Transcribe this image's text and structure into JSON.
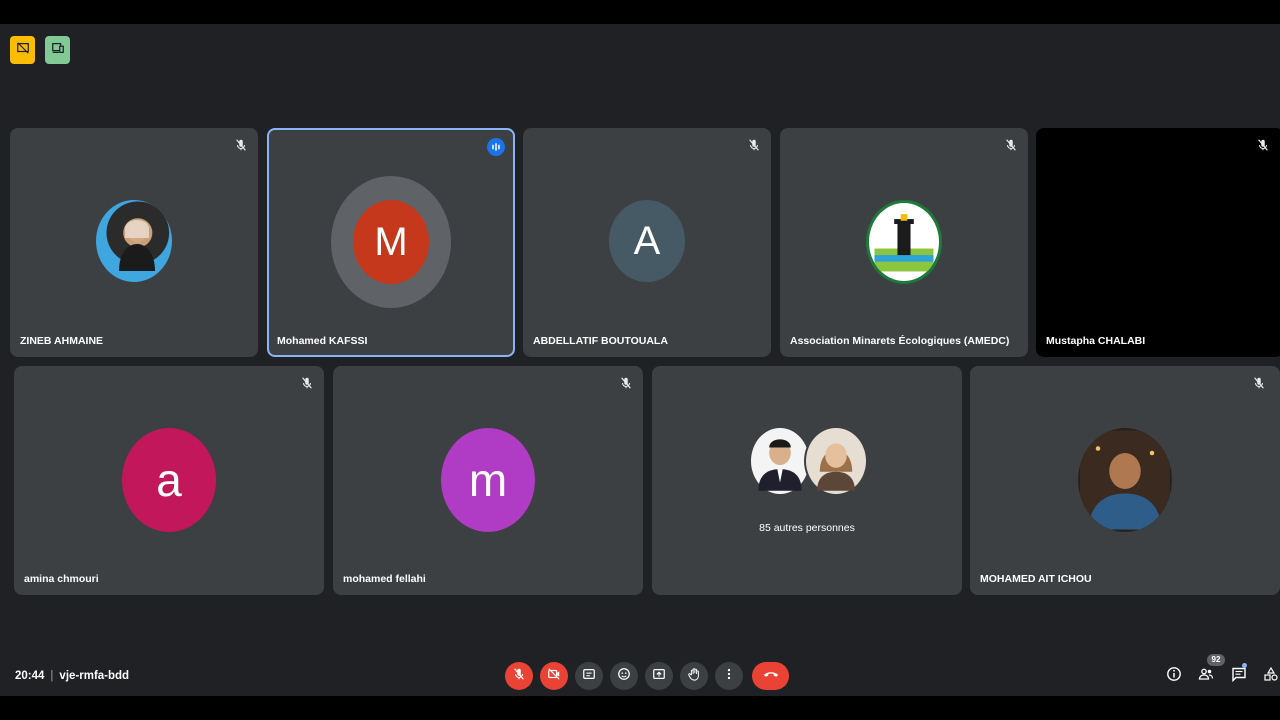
{
  "top_badges": [
    {
      "icon": "presentation-off-icon",
      "color": "#fbbc04"
    },
    {
      "icon": "devices-icon",
      "color": "#81c995"
    }
  ],
  "participants": [
    {
      "name": "ZINEB AHMAINE",
      "avatar_type": "photo",
      "icon": "mic-off-icon"
    },
    {
      "name": "Mohamed KAFSSI",
      "avatar_type": "letter",
      "letter": "M",
      "color": "#c5381b",
      "speaking": true,
      "icon": "speaking-icon"
    },
    {
      "name": "ABDELLATIF BOUTOUALA",
      "avatar_type": "letter",
      "letter": "A",
      "color": "#455a64",
      "icon": "mic-off-icon"
    },
    {
      "name": "Association Minarets Écologiques (AMEDC)",
      "avatar_type": "logo",
      "icon": "mic-off-icon"
    },
    {
      "name": "Mustapha CHALABI",
      "avatar_type": "video-off",
      "icon": "mic-off-icon"
    },
    {
      "name": "amina chmouri",
      "avatar_type": "letter",
      "letter": "a",
      "color": "#c2185b",
      "icon": "mic-off-icon"
    },
    {
      "name": "mohamed fellahi",
      "avatar_type": "letter",
      "letter": "m",
      "color": "#b03bc4",
      "icon": "mic-off-icon"
    },
    {
      "name": "MOHAMED AIT ICHOU",
      "avatar_type": "photo",
      "icon": "mic-off-icon"
    }
  ],
  "others_tile": {
    "label": "85 autres personnes"
  },
  "meeting": {
    "time": "20:44",
    "separator": "|",
    "code": "vje-rmfa-bdd"
  },
  "controls": [
    {
      "name": "microphone-toggle",
      "icon": "mic-off-icon",
      "state": "off"
    },
    {
      "name": "camera-toggle",
      "icon": "camera-off-icon",
      "state": "off"
    },
    {
      "name": "captions",
      "icon": "captions-icon"
    },
    {
      "name": "reactions",
      "icon": "emoji-icon"
    },
    {
      "name": "present",
      "icon": "present-icon"
    },
    {
      "name": "raise-hand",
      "icon": "hand-icon"
    },
    {
      "name": "more-options",
      "icon": "more-vert-icon"
    },
    {
      "name": "leave-call",
      "icon": "hangup-icon"
    }
  ],
  "right_panel": {
    "info_icon": "info-icon",
    "people_icon": "people-icon",
    "people_count": "92",
    "chat_icon": "chat-icon",
    "activities_icon": "activities-icon"
  },
  "colors": {
    "background": "#202124",
    "tile": "#3c4043",
    "active_border": "#8ab4f8",
    "danger": "#ea4335",
    "accent": "#1a73e8"
  }
}
